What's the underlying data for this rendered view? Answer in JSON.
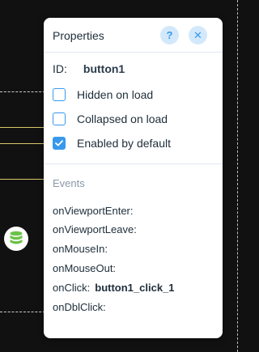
{
  "panel": {
    "title": "Properties",
    "help_glyph": "?",
    "close_glyph": "✕"
  },
  "id": {
    "label": "ID:",
    "value": "button1"
  },
  "options": [
    {
      "label": "Hidden on load",
      "checked": false
    },
    {
      "label": "Collapsed on load",
      "checked": false
    },
    {
      "label": "Enabled by default",
      "checked": true
    }
  ],
  "events": {
    "heading": "Events",
    "items": [
      {
        "name": "onViewportEnter:",
        "handler": ""
      },
      {
        "name": "onViewportLeave:",
        "handler": ""
      },
      {
        "name": "onMouseIn:",
        "handler": ""
      },
      {
        "name": "onMouseOut:",
        "handler": ""
      },
      {
        "name": "onClick:",
        "handler": "button1_click_1"
      },
      {
        "name": "onDblClick:",
        "handler": ""
      }
    ]
  },
  "colors": {
    "accent": "#3899ec",
    "accent_light": "#d3e9fb",
    "background": "#111111",
    "database_icon": "#6cc24a"
  },
  "icons": {
    "database": "database-icon",
    "check": "checkmark-icon"
  }
}
